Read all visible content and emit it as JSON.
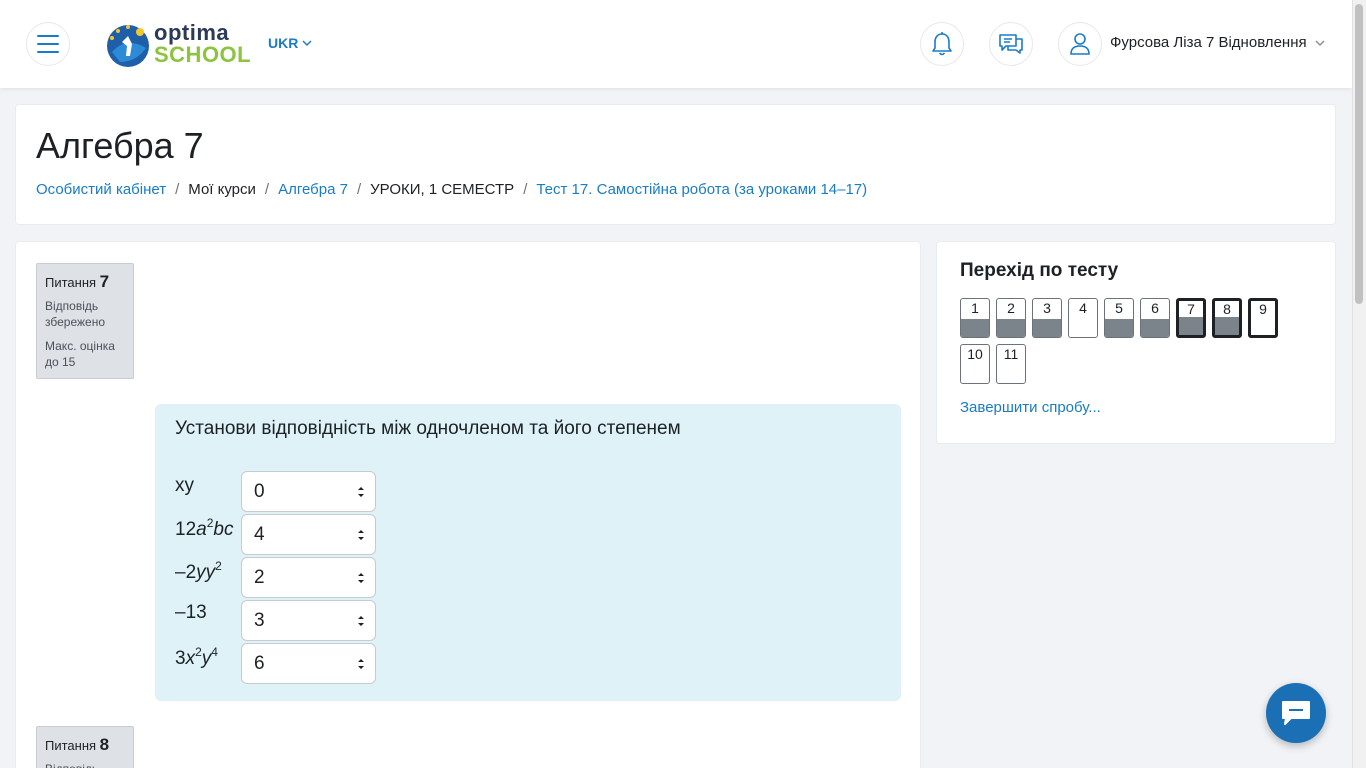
{
  "header": {
    "logo_top": "optima",
    "logo_bottom": "SCHOOL",
    "language": "UKR",
    "user_name": "Фурсова Ліза 7 Відновлення"
  },
  "page": {
    "title": "Алгебра 7",
    "breadcrumb": [
      {
        "label": "Особистий кабінет",
        "link": true
      },
      {
        "label": "Мої курси",
        "link": false
      },
      {
        "label": "Алгебра 7",
        "link": true
      },
      {
        "label": "УРОКИ, 1 СЕМЕСТР",
        "link": false
      },
      {
        "label": "Тест 17. Самостійна робота (за уроками 14–17)",
        "link": true
      }
    ]
  },
  "question7": {
    "label": "Питання",
    "number": "7",
    "state": "Відповідь збережено",
    "grade": "Макс. оцінка до 15",
    "text": "Установи відповідність між одночленом та його степенем",
    "rows": [
      {
        "term_html": "xy",
        "selected": "0"
      },
      {
        "term_html": "12<i>a</i><sup>2</sup><i>bc</i>",
        "selected": "4"
      },
      {
        "term_html": "–2<i>yy</i><sup>2</sup>",
        "selected": "2"
      },
      {
        "term_html": "–13",
        "selected": "3"
      },
      {
        "term_html": "3<i>x</i><sup>2</sup><i>y</i><sup>4</sup>",
        "selected": "6"
      }
    ]
  },
  "question8": {
    "label": "Питання",
    "number": "8",
    "state": "Відповідь"
  },
  "quiz_nav": {
    "title": "Перехід по тесту",
    "buttons": [
      {
        "label": "1",
        "answered": true,
        "current": false
      },
      {
        "label": "2",
        "answered": true,
        "current": false
      },
      {
        "label": "3",
        "answered": true,
        "current": false
      },
      {
        "label": "4",
        "answered": false,
        "current": false
      },
      {
        "label": "5",
        "answered": true,
        "current": false
      },
      {
        "label": "6",
        "answered": true,
        "current": false
      },
      {
        "label": "7",
        "answered": true,
        "current": true
      },
      {
        "label": "8",
        "answered": true,
        "current": true
      },
      {
        "label": "9",
        "answered": false,
        "current": true
      },
      {
        "label": "10",
        "answered": false,
        "current": false
      },
      {
        "label": "11",
        "answered": false,
        "current": false
      }
    ],
    "finish_label": "Завершити спробу..."
  },
  "icons": {
    "menu": "hamburger-icon",
    "bell": "bell-icon",
    "messages": "chat-icon",
    "user": "user-icon",
    "fab": "chat-bubble-icon"
  },
  "colors": {
    "accent": "#1a7cc7",
    "formulation_bg": "#def2f8",
    "answered_fill": "#7b838b"
  }
}
